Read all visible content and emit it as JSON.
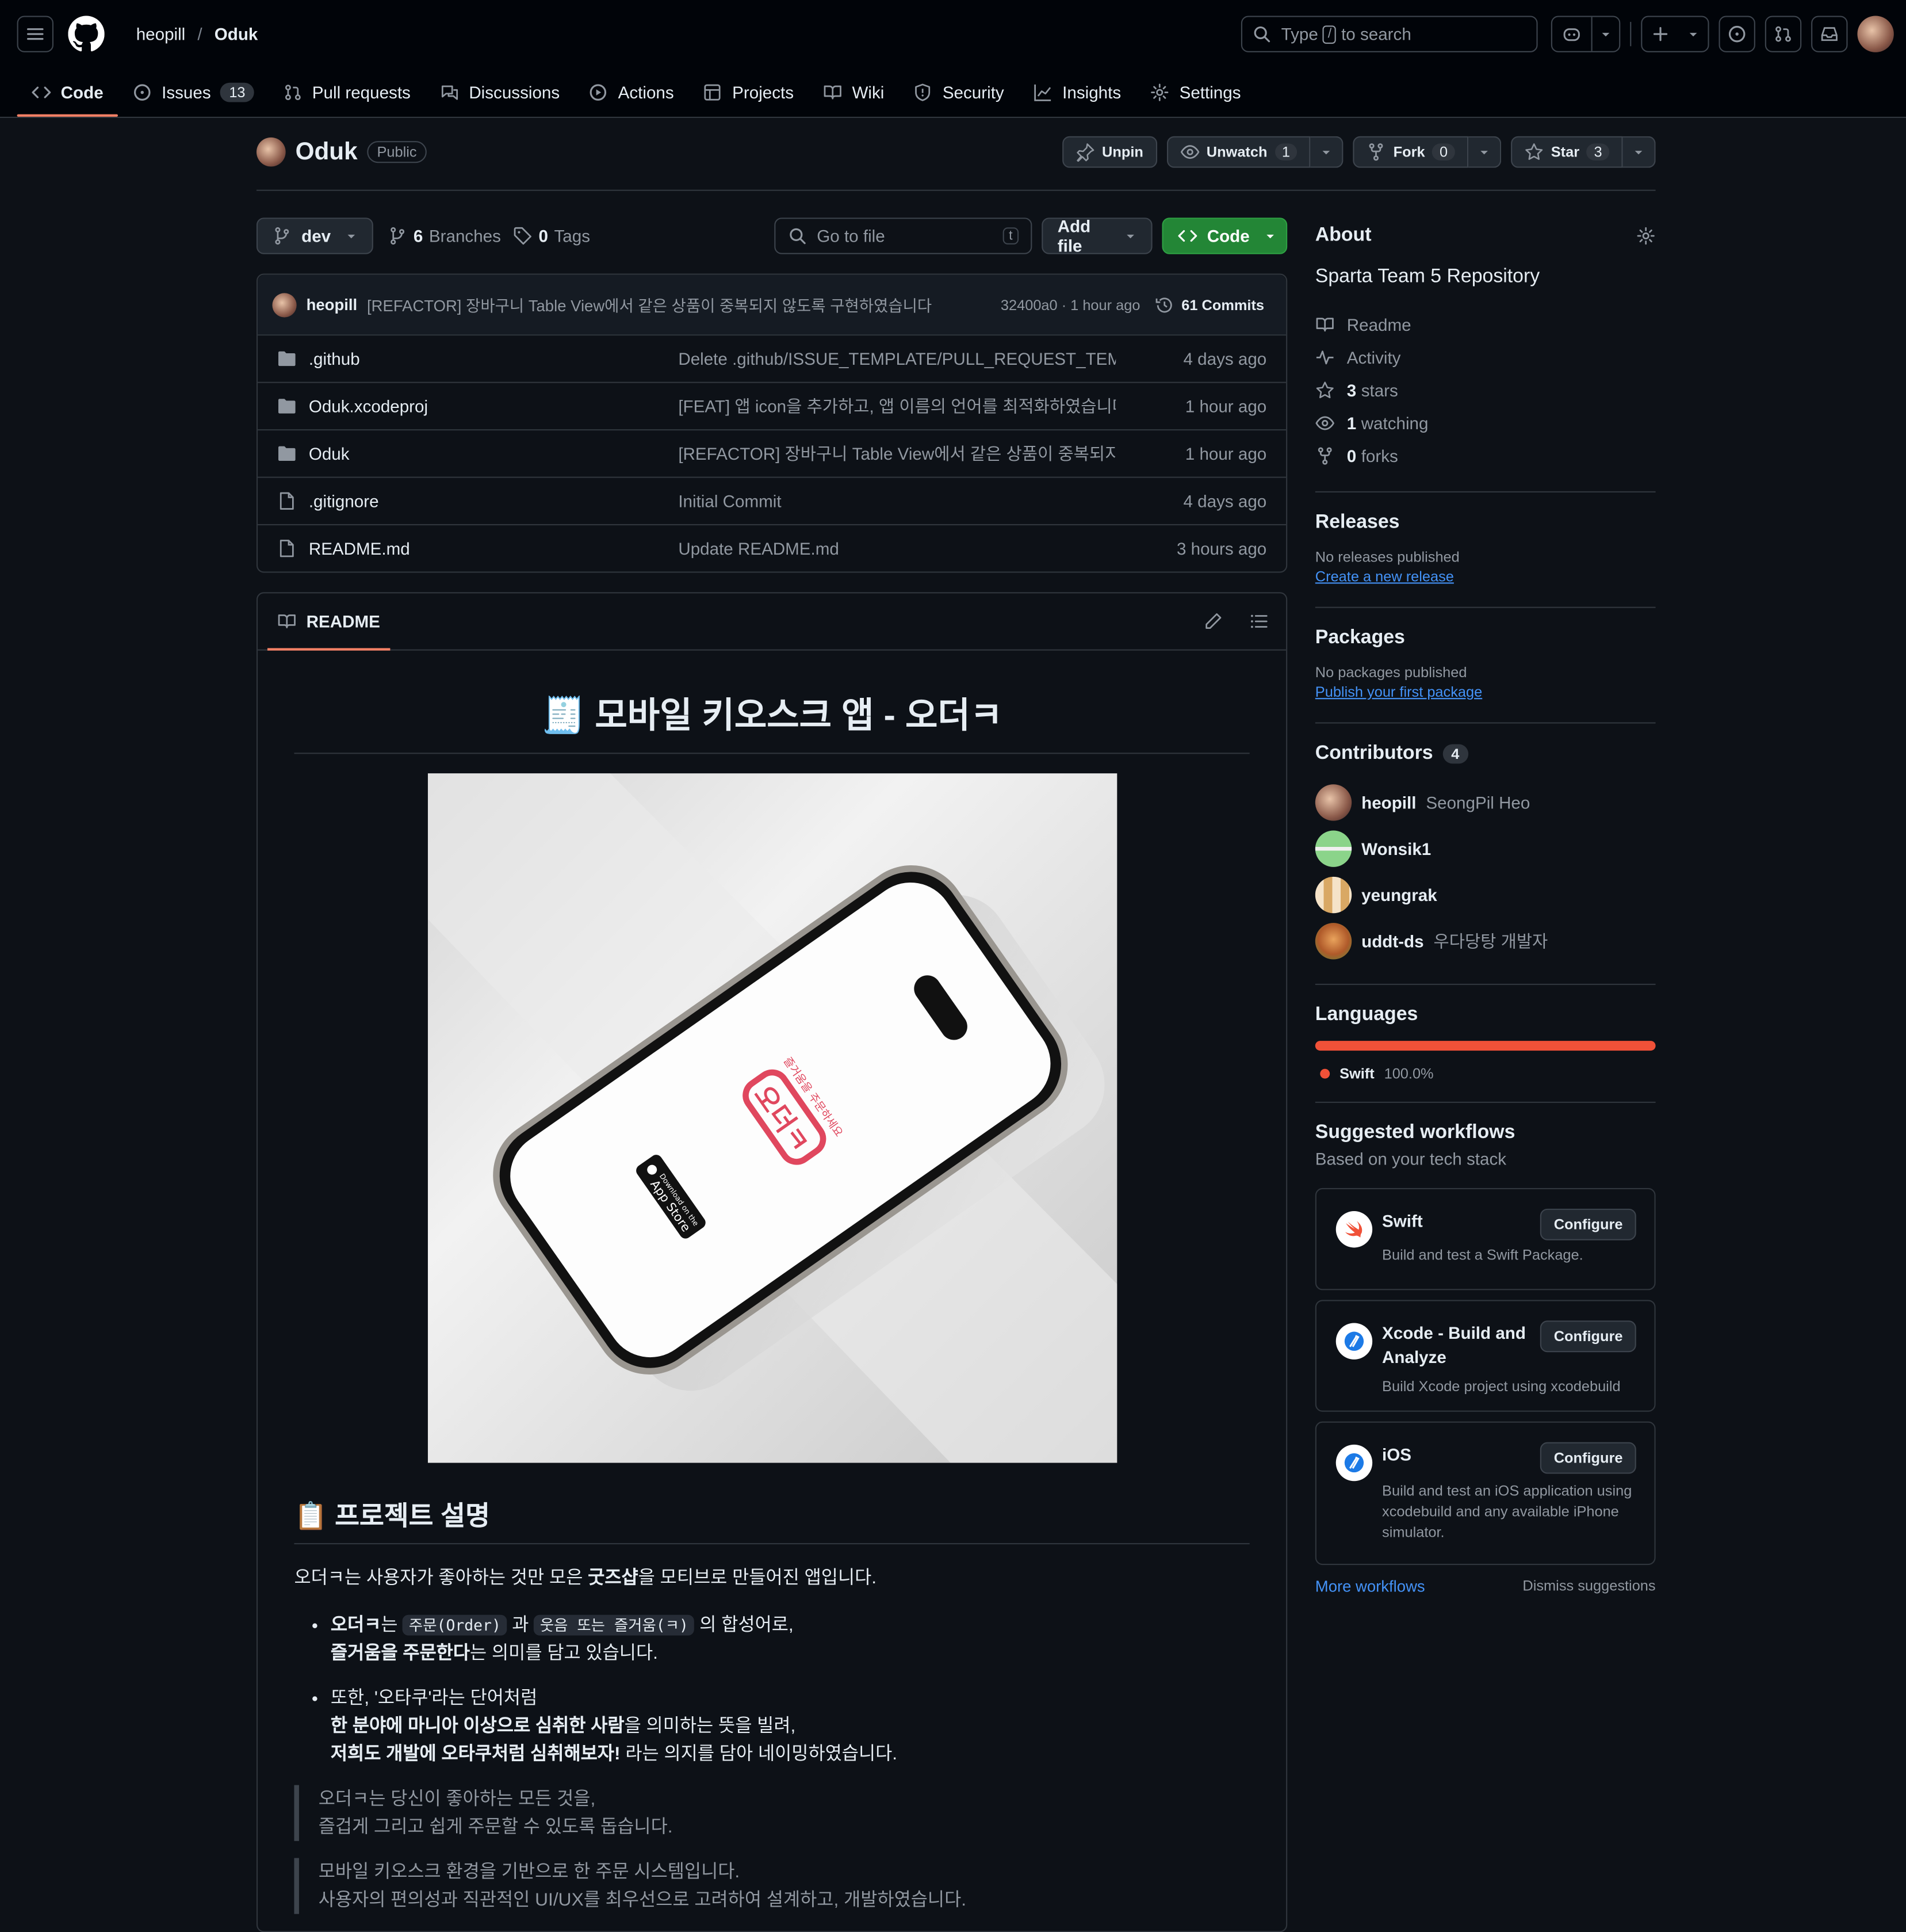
{
  "header": {
    "owner": "heopill",
    "separator": "/",
    "repo": "Oduk",
    "search_prefix": "Type",
    "search_key": "/",
    "search_suffix": "to search"
  },
  "tabs": [
    {
      "label": "Code",
      "icon": "code-icon"
    },
    {
      "label": "Issues",
      "count": "13",
      "icon": "issue-icon"
    },
    {
      "label": "Pull requests",
      "icon": "pull-request-icon"
    },
    {
      "label": "Discussions",
      "icon": "discussion-icon"
    },
    {
      "label": "Actions",
      "icon": "play-icon"
    },
    {
      "label": "Projects",
      "icon": "table-icon"
    },
    {
      "label": "Wiki",
      "icon": "book-icon"
    },
    {
      "label": "Security",
      "icon": "shield-icon"
    },
    {
      "label": "Insights",
      "icon": "graph-icon"
    },
    {
      "label": "Settings",
      "icon": "gear-icon"
    }
  ],
  "repo": {
    "name": "Oduk",
    "visibility": "Public",
    "unpin": "Unpin",
    "unwatch": "Unwatch",
    "watch_count": "1",
    "fork": "Fork",
    "fork_count": "0",
    "star": "Star",
    "star_count": "3"
  },
  "toolbar": {
    "branch": "dev",
    "branches_count": "6",
    "branches_label": "Branches",
    "tags_count": "0",
    "tags_label": "Tags",
    "goto_placeholder": "Go to file",
    "goto_key": "t",
    "add_file": "Add file",
    "code": "Code"
  },
  "last_commit": {
    "author": "heopill",
    "message": "[REFACTOR] 장바구니 Table View에서 같은 상품이 중복되지 않도록 구현하였습니다",
    "sha_time": "32400a0 · 1 hour ago",
    "commits": "61 Commits"
  },
  "files": [
    {
      "type": "folder",
      "name": ".github",
      "message": "Delete .github/ISSUE_TEMPLATE/PULL_REQUEST_TEMP...",
      "age": "4 days ago"
    },
    {
      "type": "folder",
      "name": "Oduk.xcodeproj",
      "message": "[FEAT] 앱 icon을 추가하고, 앱 이름의 언어를 최적화하였습니다.",
      "age": "1 hour ago"
    },
    {
      "type": "folder",
      "name": "Oduk",
      "message": "[REFACTOR] 장바구니 Table View에서 같은 상품이 중복되지 않...",
      "age": "1 hour ago"
    },
    {
      "type": "file",
      "name": ".gitignore",
      "message": "Initial Commit",
      "age": "4 days ago"
    },
    {
      "type": "file",
      "name": "README.md",
      "message": "Update README.md",
      "age": "3 hours ago"
    }
  ],
  "readme": {
    "tab": "README",
    "title": "🧾 모바일 키오스크 앱 - 오더ㅋ",
    "hero_logo": "오더ㅋ",
    "hero_logo_sub": "즐거움을 주문하세요",
    "hero_badge_small": "Download on the",
    "hero_badge": "App Store",
    "h2": "📋 프로젝트 설명",
    "intro_a": "오더ㅋ는 사용자가 좋아하는 것만 모은 ",
    "intro_b": "굿즈샵",
    "intro_c": "을 모티브로 만들어진 앱입니다.",
    "li1_a": "오더ㅋ",
    "li1_b": "는 ",
    "li1_code1": "주문(Order)",
    "li1_c": " 과 ",
    "li1_code2": "웃음 또는 즐거움(ㅋ)",
    "li1_d": " 의 합성어로,",
    "li1_e": "즐거움을 주문한다",
    "li1_f": "는 의미를 담고 있습니다.",
    "li2_a": "또한, '오타쿠'라는 단어처럼",
    "li2_b": "한 분야에 마니아 이상으로 심취한 사람",
    "li2_c": "을 의미하는 뜻을 빌려,",
    "li2_d": "저희도 개발에 오타쿠처럼 심취해보자!",
    "li2_e": " 라는 의지를 담아 네이밍하였습니다.",
    "bq1_a": "오더ㅋ는 당신이 좋아하는 모든 것을,",
    "bq1_b": "즐겁게 그리고 쉽게 주문할 수 있도록 돕습니다.",
    "bq2_a": "모바일 키오스크 환경을 기반으로 한 주문 시스템입니다.",
    "bq2_b": "사용자의 편의성과 직관적인 UI/UX를 최우선으로 고려하여 설계하고, 개발하였습니다."
  },
  "about": {
    "title": "About",
    "description": "Sparta Team 5 Repository",
    "readme": "Readme",
    "activity": "Activity",
    "stars_n": "3",
    "stars": "stars",
    "watching_n": "1",
    "watching": "watching",
    "forks_n": "0",
    "forks": "forks"
  },
  "releases": {
    "title": "Releases",
    "none": "No releases published",
    "link": "Create a new release"
  },
  "packages": {
    "title": "Packages",
    "none": "No packages published",
    "link": "Publish your first package"
  },
  "contributors": {
    "title": "Contributors",
    "count": "4",
    "items": [
      {
        "login": "heopill",
        "name": "SeongPil Heo"
      },
      {
        "login": "Wonsik1",
        "name": ""
      },
      {
        "login": "yeungrak",
        "name": ""
      },
      {
        "login": "uddt-ds",
        "name": "우다당탕 개발자"
      }
    ]
  },
  "languages": {
    "title": "Languages",
    "name": "Swift",
    "percent": "100.0%",
    "color": "#f05138",
    "fraction": 1.0
  },
  "workflows": {
    "title": "Suggested workflows",
    "subtitle": "Based on your tech stack",
    "items": [
      {
        "title": "Swift",
        "desc": "Build and test a Swift Package.",
        "button": "Configure"
      },
      {
        "title": "Xcode - Build and Analyze",
        "desc": "Build Xcode project using xcodebuild",
        "button": "Configure"
      },
      {
        "title": "iOS",
        "desc": "Build and test an iOS application using xcodebuild and any available iPhone simulator.",
        "button": "Configure"
      }
    ],
    "more": "More workflows",
    "dismiss": "Dismiss suggestions"
  },
  "colors": {
    "accent": "#f78166",
    "primary_button": "#238636",
    "link": "#4493f8"
  }
}
